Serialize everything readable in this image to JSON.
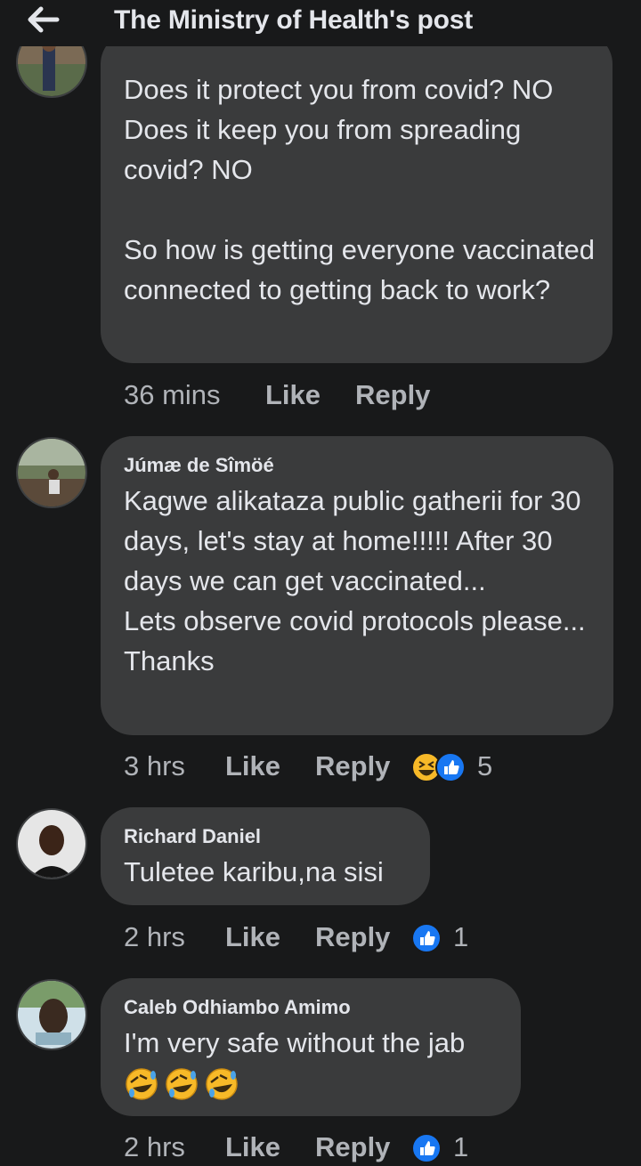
{
  "header": {
    "title": "The Ministry of Health's post",
    "back_icon": "back-arrow-icon"
  },
  "comments": [
    {
      "author": "",
      "text": "Does it protect you from covid? NO\nDoes it keep you from spreading covid? NO\n\nSo how is getting everyone vaccinated connected to getting back to work?",
      "time": "36 mins",
      "like": "Like",
      "reply": "Reply",
      "reaction_count": ""
    },
    {
      "author": "Júmæ de Sîmöé",
      "text": "Kagwe alikataza public gatherii for 30 days, let's stay at home!!!!! After 30 days we can get vaccinated...\nLets observe covid protocols please...\nThanks",
      "time": "3 hrs",
      "like": "Like",
      "reply": "Reply",
      "reaction_count": "5",
      "reactions": [
        "haha-icon",
        "like-icon"
      ]
    },
    {
      "author": "Richard Daniel",
      "text": "Tuletee karibu,na sisi",
      "time": "2 hrs",
      "like": "Like",
      "reply": "Reply",
      "reaction_count": "1",
      "reactions": [
        "like-icon"
      ]
    },
    {
      "author": "Caleb Odhiambo Amimo",
      "text": "I'm very safe without the jab",
      "emojis": [
        "rolling-on-floor-laughing-emoji",
        "rolling-on-floor-laughing-emoji",
        "rolling-on-floor-laughing-emoji"
      ],
      "time": "2 hrs",
      "like": "Like",
      "reply": "Reply",
      "reaction_count": "1",
      "reactions": [
        "like-icon"
      ]
    }
  ],
  "colors": {
    "background": "#18191a",
    "bubble": "#3a3b3c",
    "text": "#e4e6eb",
    "meta": "#b0b3b8",
    "like_blue": "#1877f2",
    "haha_yellow": "#f7b928"
  }
}
